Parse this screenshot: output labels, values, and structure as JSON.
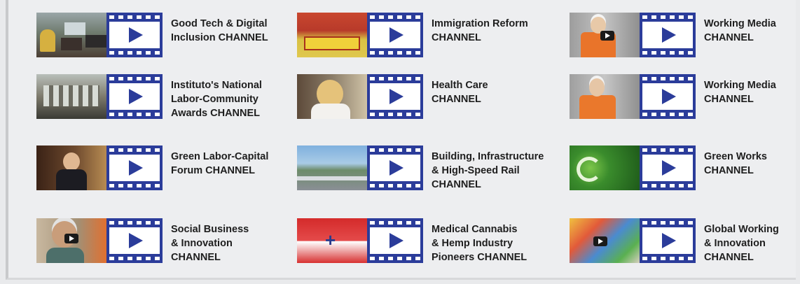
{
  "channels": [
    {
      "label": "Good Tech & Digital\nInclusion CHANNEL",
      "thumb": "t-good",
      "yt": false
    },
    {
      "label": "Immigration Reform\nCHANNEL",
      "thumb": "t-immig",
      "yt": false
    },
    {
      "label": "Working Media\nCHANNEL",
      "thumb": "t-work1",
      "yt": true
    },
    {
      "label": "Instituto's National\nLabor-Community\nAwards CHANNEL",
      "thumb": "t-inst",
      "yt": false
    },
    {
      "label": "Health Care\nCHANNEL",
      "thumb": "t-health",
      "yt": false
    },
    {
      "label": "Working Media\nCHANNEL",
      "thumb": "t-work2",
      "yt": false
    },
    {
      "label": "Green Labor-Capital\nForum CHANNEL",
      "thumb": "t-green",
      "yt": false
    },
    {
      "label": "Building, Infrastructure\n& High-Speed Rail\nCHANNEL",
      "thumb": "t-rail",
      "yt": false
    },
    {
      "label": "Green Works\nCHANNEL",
      "thumb": "t-works",
      "yt": false
    },
    {
      "label": "Social Business\n& Innovation\nCHANNEL",
      "thumb": "t-social",
      "yt": true
    },
    {
      "label": "Medical Cannabis\n& Hemp Industry\nPioneers CHANNEL",
      "thumb": "t-cannabis",
      "yt": false
    },
    {
      "label": "Global Working\n& Innovation\nCHANNEL",
      "thumb": "t-global",
      "yt": true
    }
  ],
  "colors": {
    "play_frame": "#2b3c9a",
    "text": "#1e1e1e",
    "background": "#edeef0"
  },
  "icons": {
    "play": "film-play-icon",
    "youtube": "youtube-play-icon"
  }
}
